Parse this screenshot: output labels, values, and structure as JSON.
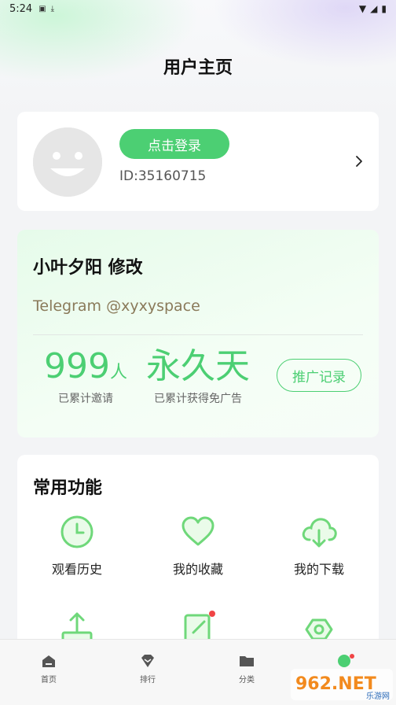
{
  "status_bar": {
    "time": "5:24"
  },
  "page_title": "用户主页",
  "profile": {
    "login_label": "点击登录",
    "user_id": "ID:35160715"
  },
  "promo": {
    "title": "小叶夕阳 修改",
    "subtitle": "Telegram @xyxyspace",
    "invite_value": "999",
    "invite_unit": "人",
    "invite_label": "已累计邀请",
    "days_value": "永久天",
    "days_label": "已累计获得免广告",
    "record_label": "推广记录"
  },
  "functions": {
    "title": "常用功能",
    "items": [
      {
        "label": "观看历史",
        "icon": "clock-icon"
      },
      {
        "label": "我的收藏",
        "icon": "heart-icon"
      },
      {
        "label": "我的下载",
        "icon": "cloud-download-icon"
      }
    ]
  },
  "tabs": [
    {
      "label": "首页",
      "icon": "home-icon"
    },
    {
      "label": "排行",
      "icon": "rank-icon"
    },
    {
      "label": "分类",
      "icon": "folder-icon"
    }
  ],
  "watermark": {
    "text": "962.NET",
    "sub": "乐游网"
  },
  "colors": {
    "accent": "#4ccf73",
    "dot": "#f04545",
    "promo_bg": "#eefcf1"
  }
}
